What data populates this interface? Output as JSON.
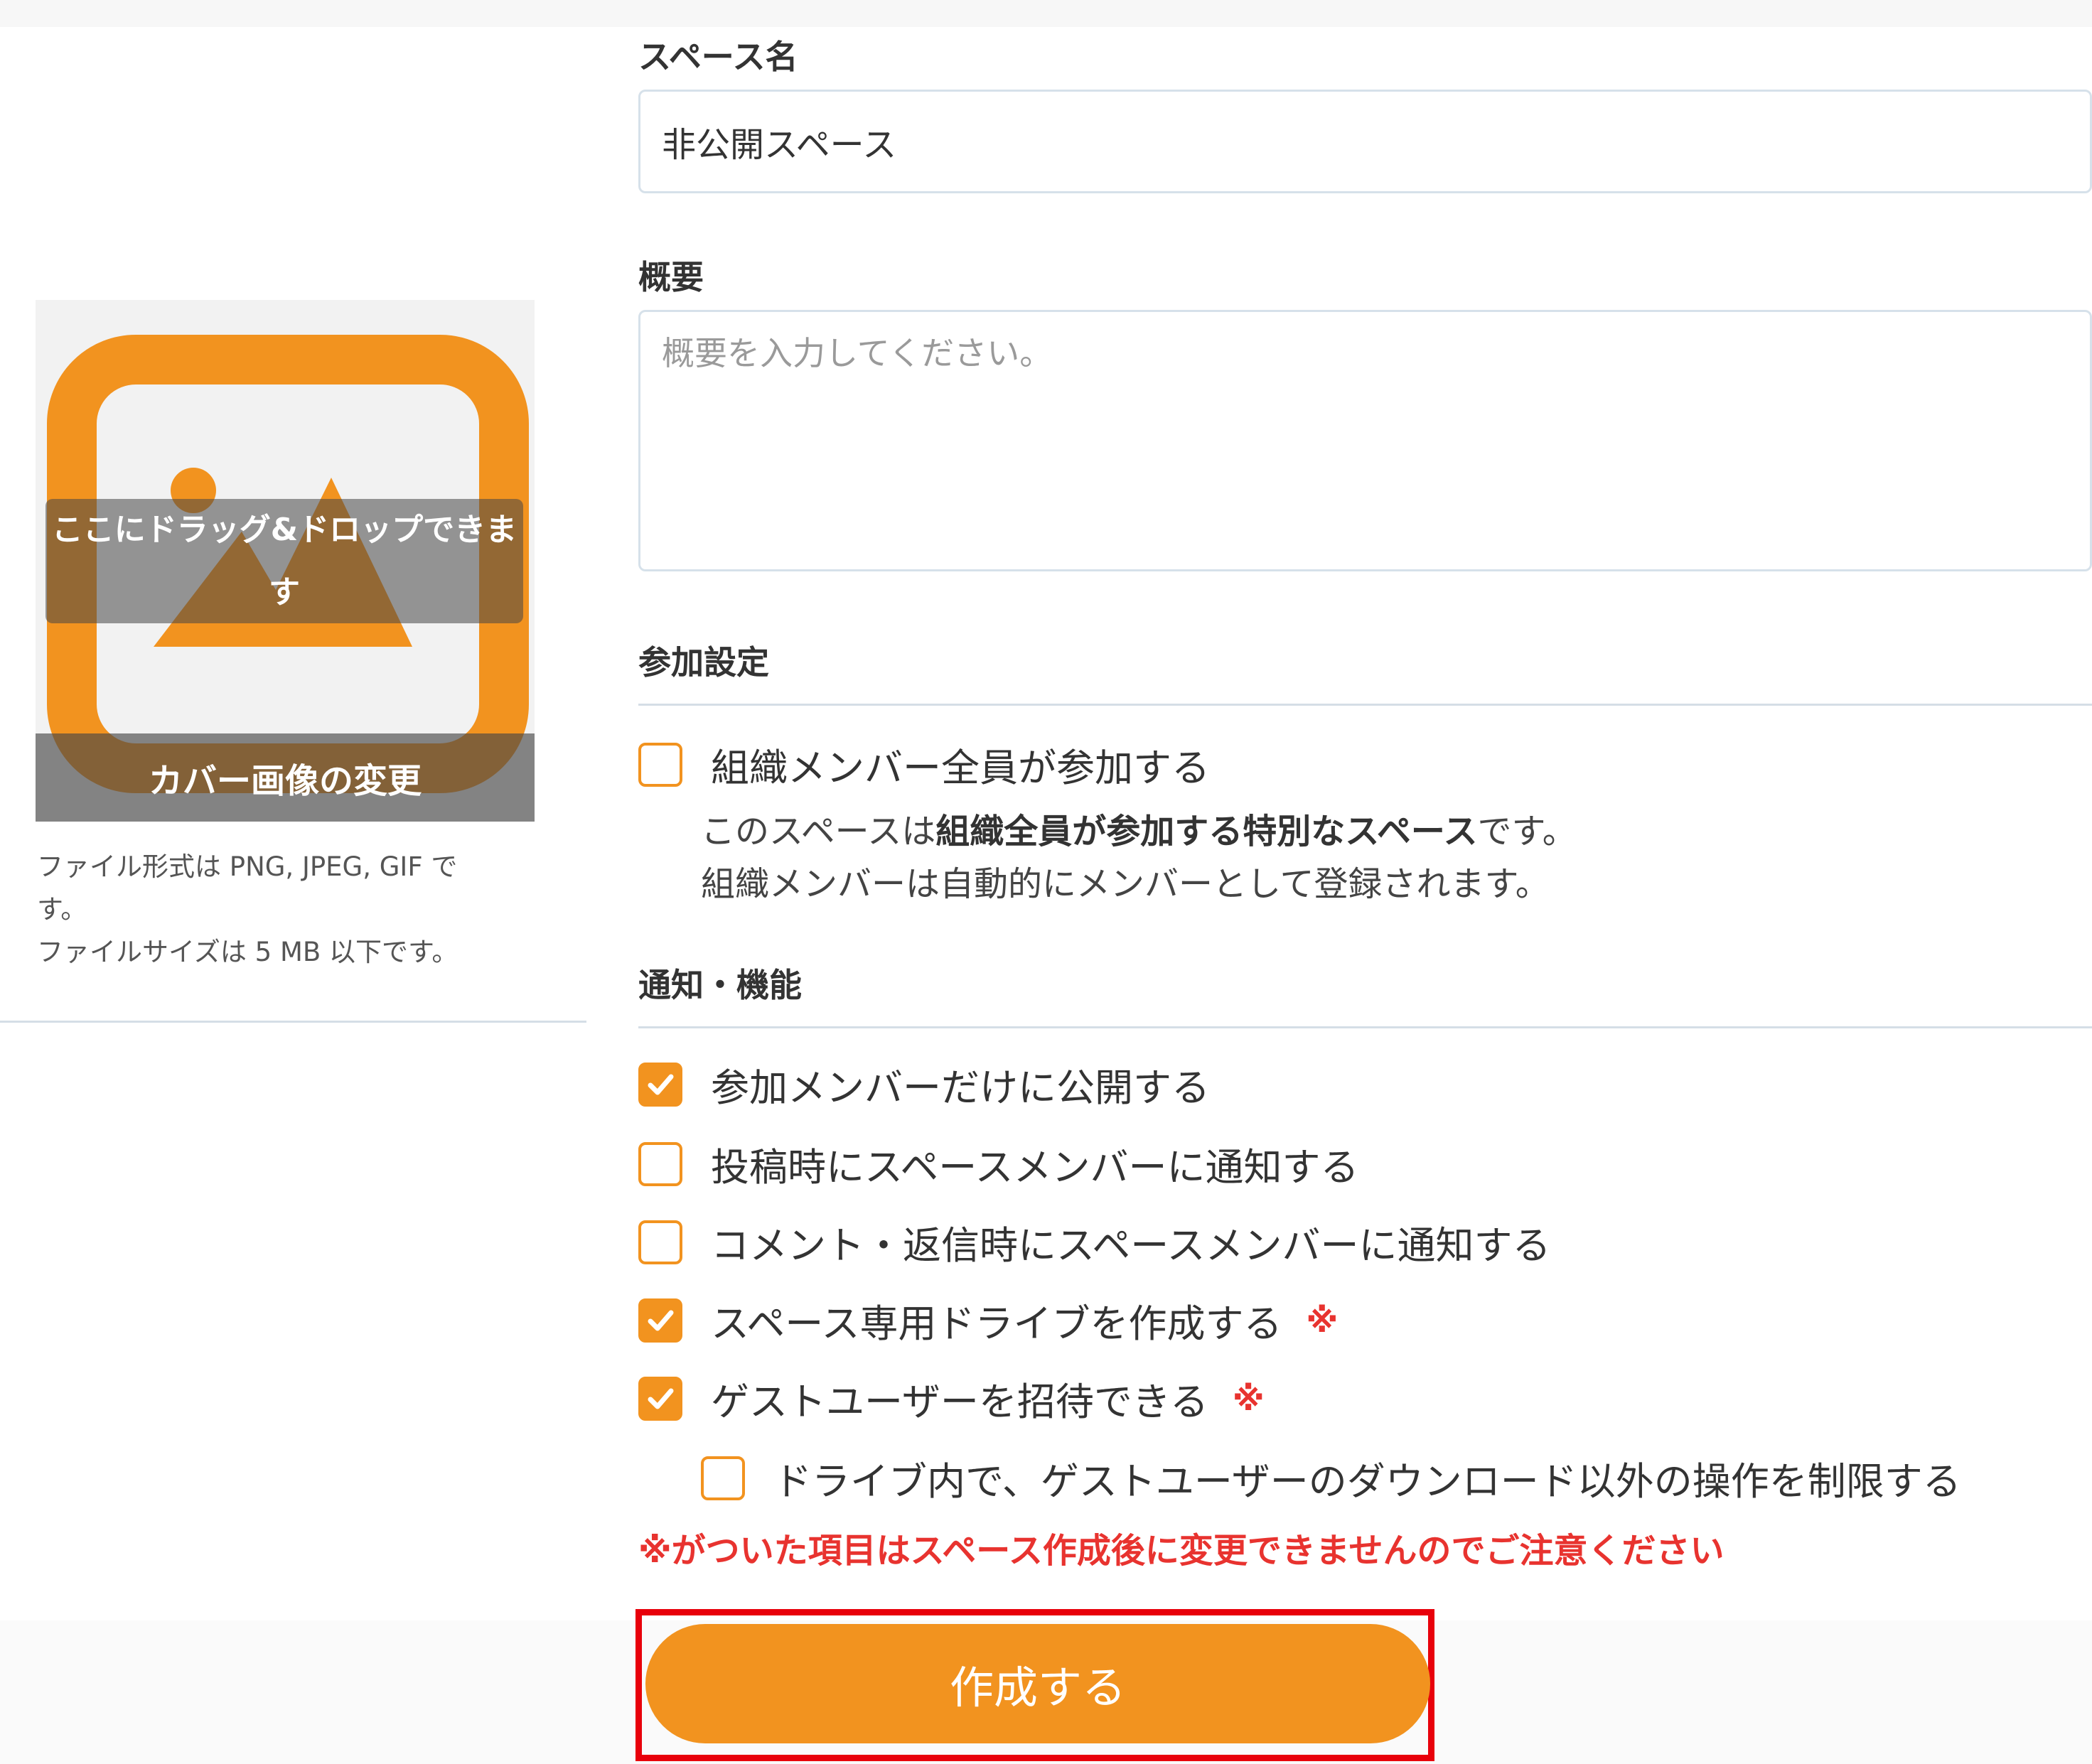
{
  "cover": {
    "drop_text": "ここにドラッグ&ドロップできます",
    "change_label": "カバー画像の変更",
    "file_format_note": "ファイル形式は PNG, JPEG, GIF です。",
    "file_size_note": "ファイルサイズは 5 MB 以下です。",
    "icon": "image-placeholder-icon",
    "accent_color": "#f2931f"
  },
  "form": {
    "space_name": {
      "label": "スペース名",
      "value": "非公開スペース"
    },
    "summary": {
      "label": "概要",
      "placeholder": "概要を入力してください。",
      "value": ""
    }
  },
  "participation": {
    "heading": "参加設定",
    "all_members": {
      "label": "組織メンバー全員が参加する",
      "checked": false
    },
    "desc_line1_prefix": "このスペースは",
    "desc_line1_bold": "組織全員が参加する特別なスペース",
    "desc_line1_suffix": "です。",
    "desc_line2": "組織メンバーは自動的にメンバーとして登録されます。"
  },
  "features": {
    "heading": "通知・機能",
    "options": [
      {
        "label": "参加メンバーだけに公開する",
        "checked": true,
        "mark": ""
      },
      {
        "label": "投稿時にスペースメンバーに通知する",
        "checked": false,
        "mark": ""
      },
      {
        "label": "コメント・返信時にスペースメンバーに通知する",
        "checked": false,
        "mark": ""
      },
      {
        "label": "スペース専用ドライブを作成する",
        "checked": true,
        "mark": "※"
      },
      {
        "label": "ゲストユーザーを招待できる",
        "checked": true,
        "mark": "※"
      }
    ],
    "guest_restrict": {
      "label": "ドライブ内で、ゲストユーザーのダウンロード以外の操作を制限する",
      "checked": false
    }
  },
  "warning": "※がついた項目はスペース作成後に変更できませんのでご注意ください",
  "actions": {
    "create_label": "作成する"
  },
  "colors": {
    "accent": "#f2931f",
    "warning": "#e8332f",
    "highlight": "#e8000b"
  }
}
